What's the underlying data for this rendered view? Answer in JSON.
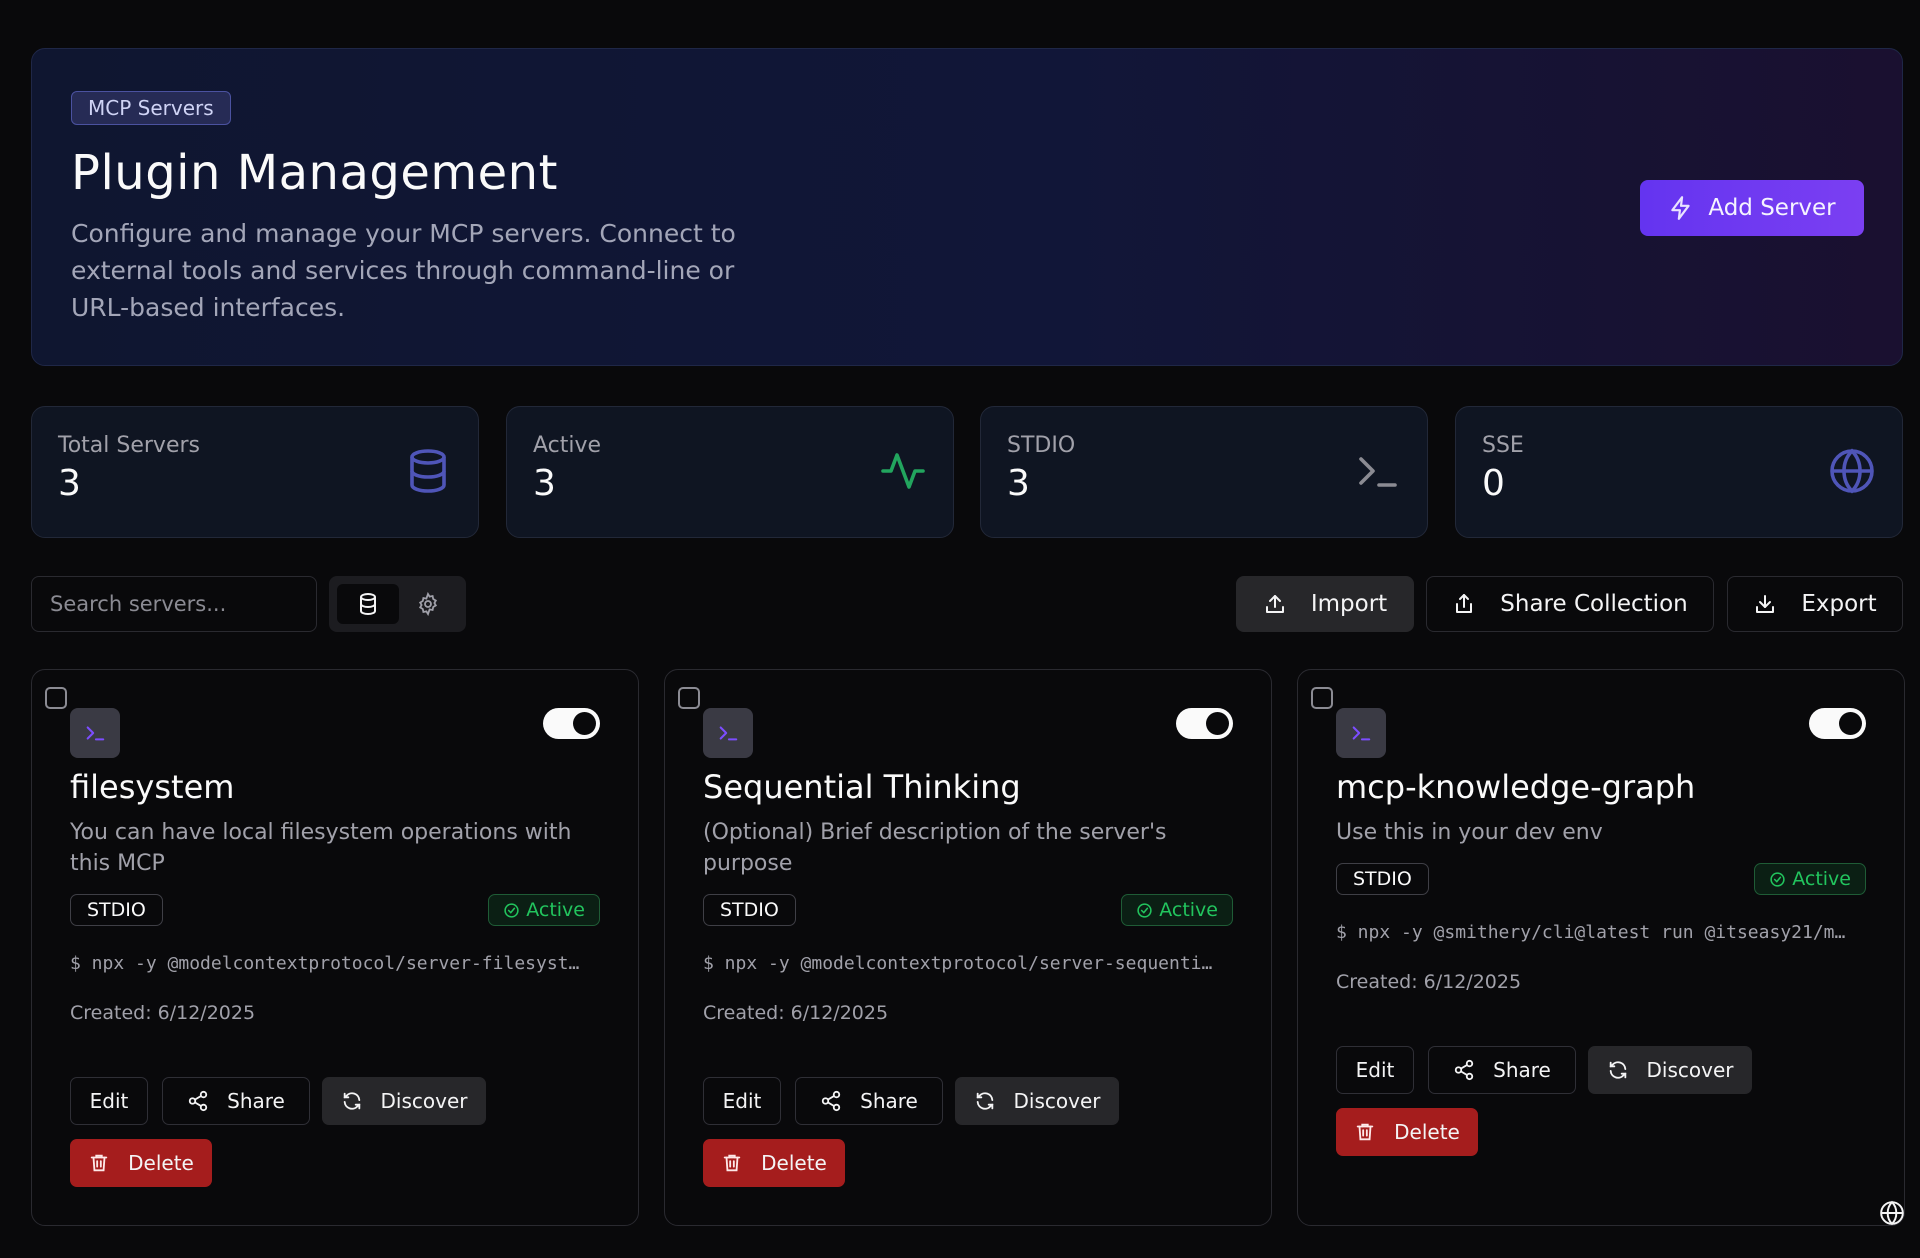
{
  "header": {
    "badge": "MCP Servers",
    "title": "Plugin Management",
    "description": "Configure and manage your MCP servers. Connect to external tools and services through command-line or URL-based interfaces.",
    "add_server_label": "Add Server"
  },
  "stats": [
    {
      "label": "Total Servers",
      "value": "3",
      "icon": "database-icon",
      "color": "#4f55b8"
    },
    {
      "label": "Active",
      "value": "3",
      "icon": "activity-icon",
      "color": "#22a55e"
    },
    {
      "label": "STDIO",
      "value": "3",
      "icon": "terminal-icon",
      "color": "#8b8b93"
    },
    {
      "label": "SSE",
      "value": "0",
      "icon": "globe-icon",
      "color": "#4f55b8"
    }
  ],
  "toolbar": {
    "search_placeholder": "Search servers...",
    "import_label": "Import",
    "share_collection_label": "Share Collection",
    "export_label": "Export"
  },
  "servers": [
    {
      "name": "filesystem",
      "description": "You can have local filesystem operations with this MCP",
      "type": "STDIO",
      "status": "Active",
      "command": "$ npx -y @modelcontextprotocol/server-filesyst…",
      "created": "Created: 6/12/2025",
      "enabled": true
    },
    {
      "name": "Sequential Thinking",
      "description": "(Optional) Brief description of the server's purpose",
      "type": "STDIO",
      "status": "Active",
      "command": "$ npx -y @modelcontextprotocol/server-sequenti…",
      "created": "Created: 6/12/2025",
      "enabled": true
    },
    {
      "name": "mcp-knowledge-graph",
      "description": "Use this in your dev env",
      "type": "STDIO",
      "status": "Active",
      "command": "$ npx -y @smithery/cli@latest run @itseasy21/m…",
      "created": "Created: 6/12/2025",
      "enabled": true
    }
  ],
  "card_actions": {
    "edit": "Edit",
    "share": "Share",
    "discover": "Discover",
    "delete": "Delete"
  },
  "colors": {
    "background": "#09090b",
    "accent": "#6d38f2",
    "active_green": "#22c55e",
    "delete_red": "#a51d1d"
  }
}
